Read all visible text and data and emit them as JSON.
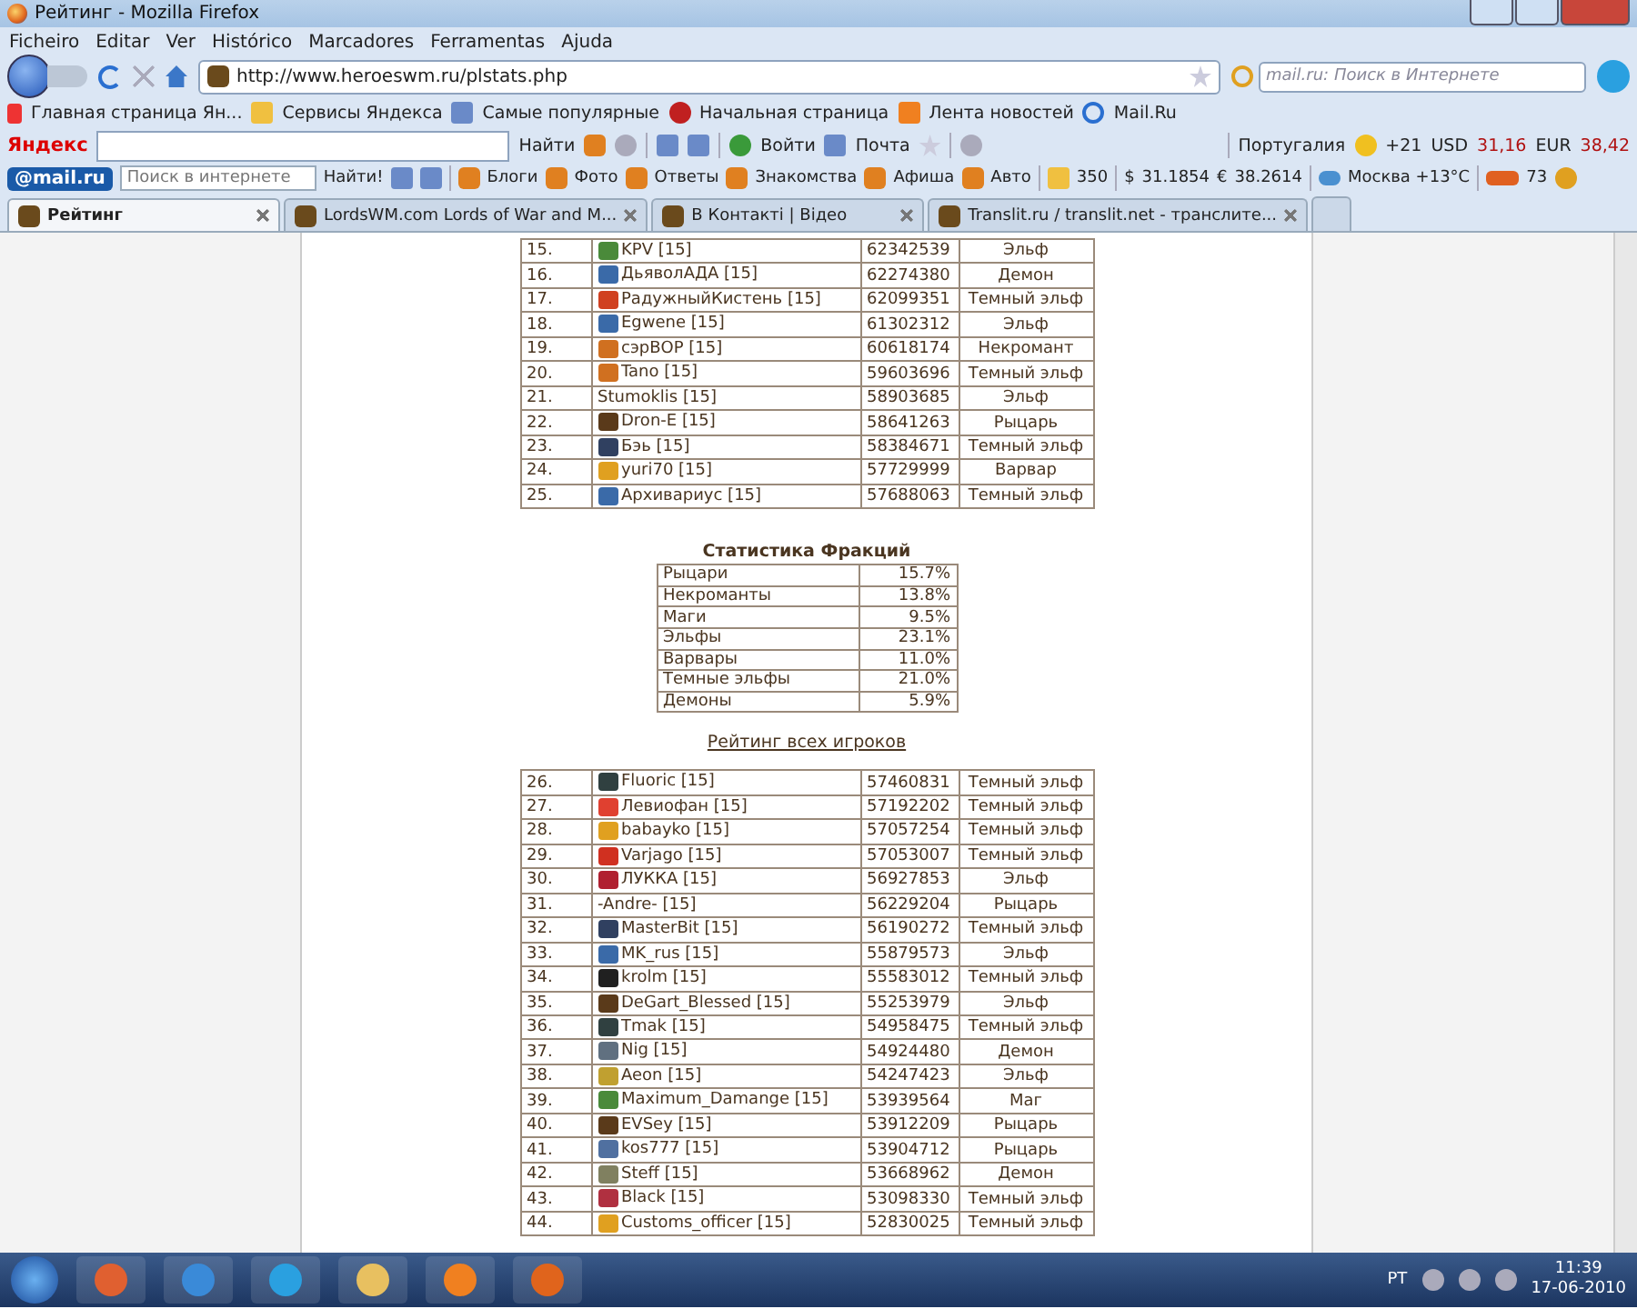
{
  "window": {
    "title": "Рейтинг - Mozilla Firefox"
  },
  "menu": [
    "Ficheiro",
    "Editar",
    "Ver",
    "Histórico",
    "Marcadores",
    "Ferramentas",
    "Ajuda"
  ],
  "navigation": {
    "url": "http://www.heroeswm.ru/plstats.php",
    "search": {
      "placeholder": "mail.ru: Поиск в Интернете"
    }
  },
  "bookmarks": [
    "Главная страница Ян...",
    "Сервисы Яндекса",
    "Самые популярные",
    "Начальная страница",
    "Лента новостей",
    "Mail.Ru"
  ],
  "yandex_bar": {
    "logo": "Яндекс",
    "find": "Найти",
    "login": "Войти",
    "mail": "Почта",
    "region": "Португалия",
    "temperature": "+21",
    "usd_label": "USD",
    "usd": "31,16",
    "eur_label": "EUR",
    "eur": "38,42"
  },
  "mail_bar": {
    "logo": "@mail.ru",
    "search": {
      "placeholder": "Поиск в интернете"
    },
    "find": "Найти!",
    "links": [
      "Блоги",
      "Фото",
      "Ответы",
      "Знакомства",
      "Афиша",
      "Авто"
    ],
    "messages": "350",
    "dollar_sign": "$",
    "dollar": "31.1854",
    "euro_sign": "€",
    "euro": "38.2614",
    "weather": "Москва +13°C",
    "traffic": "73"
  },
  "tabs": [
    {
      "label": "Рейтинг",
      "selected": true
    },
    {
      "label": "LordsWM.com Lords of War and M...",
      "selected": false
    },
    {
      "label": "В Контакті | Відео",
      "selected": false
    },
    {
      "label": "Translit.ru / translit.net - транслите...",
      "selected": false
    }
  ],
  "ranking_top": {
    "rows": [
      {
        "rank": "15.",
        "name": "KPV [15]",
        "score": "62342539",
        "faction": "Эльф",
        "color": "#4a8a3a"
      },
      {
        "rank": "16.",
        "name": "ДьяволАДА [15]",
        "score": "62274380",
        "faction": "Демон",
        "color": "#3a6aa8"
      },
      {
        "rank": "17.",
        "name": "РадужныйКистень [15]",
        "score": "62099351",
        "faction": "Темный эльф",
        "color": "#d04020"
      },
      {
        "rank": "18.",
        "name": "Egwene [15]",
        "score": "61302312",
        "faction": "Эльф",
        "color": "#3a6aa8"
      },
      {
        "rank": "19.",
        "name": "сэрВОР [15]",
        "score": "60618174",
        "faction": "Некромант",
        "color": "#d07020"
      },
      {
        "rank": "20.",
        "name": "Tano [15]",
        "score": "59603696",
        "faction": "Темный эльф",
        "color": "#d07020"
      },
      {
        "rank": "21.",
        "name": "Stumoklis [15]",
        "score": "58903685",
        "faction": "Эльф"
      },
      {
        "rank": "22.",
        "name": "Dron-E [15]",
        "score": "58641263",
        "faction": "Рыцарь",
        "color": "#5a3a1a"
      },
      {
        "rank": "23.",
        "name": "Бэь [15]",
        "score": "58384671",
        "faction": "Темный эльф",
        "color": "#304060"
      },
      {
        "rank": "24.",
        "name": "yuri70 [15]",
        "score": "57729999",
        "faction": "Варвар",
        "color": "#e0a020"
      },
      {
        "rank": "25.",
        "name": "Архивариус [15]",
        "score": "57688063",
        "faction": "Темный эльф",
        "color": "#3a6aa8"
      }
    ]
  },
  "faction_stats": {
    "title": "Статистика Фракций",
    "rows": [
      {
        "faction": "Рыцари",
        "share": "15.7%"
      },
      {
        "faction": "Некроманты",
        "share": "13.8%"
      },
      {
        "faction": "Маги",
        "share": "9.5%"
      },
      {
        "faction": "Эльфы",
        "share": "23.1%"
      },
      {
        "faction": "Варвары",
        "share": "11.0%"
      },
      {
        "faction": "Темные эльфы",
        "share": "21.0%"
      },
      {
        "faction": "Демоны",
        "share": "5.9%"
      }
    ]
  },
  "all_players_link": "Рейтинг всех игроков",
  "ranking": {
    "rows": [
      {
        "rank": "26.",
        "name": "Fluoric [15]",
        "score": "57460831",
        "faction": "Темный эльф",
        "color": "#304040"
      },
      {
        "rank": "27.",
        "name": "Левиофан [15]",
        "score": "57192202",
        "faction": "Темный эльф",
        "color": "#e04030"
      },
      {
        "rank": "28.",
        "name": "babayko [15]",
        "score": "57057254",
        "faction": "Темный эльф",
        "color": "#e0a020"
      },
      {
        "rank": "29.",
        "name": "Varjago [15]",
        "score": "57053007",
        "faction": "Темный эльф",
        "color": "#d03020"
      },
      {
        "rank": "30.",
        "name": "ЛУККА [15]",
        "score": "56927853",
        "faction": "Эльф",
        "color": "#b02030"
      },
      {
        "rank": "31.",
        "name": "-Andre- [15]",
        "score": "56229204",
        "faction": "Рыцарь"
      },
      {
        "rank": "32.",
        "name": "MasterBit [15]",
        "score": "56190272",
        "faction": "Темный эльф",
        "color": "#304060"
      },
      {
        "rank": "33.",
        "name": "MK_rus [15]",
        "score": "55879573",
        "faction": "Эльф",
        "color": "#3a6aa8"
      },
      {
        "rank": "34.",
        "name": "krolm [15]",
        "score": "55583012",
        "faction": "Темный эльф",
        "color": "#202020"
      },
      {
        "rank": "35.",
        "name": "DeGart_Blessed [15]",
        "score": "55253979",
        "faction": "Эльф",
        "color": "#5a3a1a"
      },
      {
        "rank": "36.",
        "name": "Tmak [15]",
        "score": "54958475",
        "faction": "Темный эльф",
        "color": "#304040"
      },
      {
        "rank": "37.",
        "name": "Nig [15]",
        "score": "54924480",
        "faction": "Демон",
        "color": "#607080"
      },
      {
        "rank": "38.",
        "name": "Aeon [15]",
        "score": "54247423",
        "faction": "Эльф",
        "color": "#c0a030"
      },
      {
        "rank": "39.",
        "name": "Maximum_Damange [15]",
        "score": "53939564",
        "faction": "Маг",
        "color": "#4a8a3a"
      },
      {
        "rank": "40.",
        "name": "EVSey [15]",
        "score": "53912209",
        "faction": "Рыцарь",
        "color": "#5a3a1a"
      },
      {
        "rank": "41.",
        "name": "kos777 [15]",
        "score": "53904712",
        "faction": "Рыцарь",
        "color": "#5070a0"
      },
      {
        "rank": "42.",
        "name": "Steff [15]",
        "score": "53668962",
        "faction": "Демон",
        "color": "#808060"
      },
      {
        "rank": "43.",
        "name": "Black [15]",
        "score": "53098330",
        "faction": "Темный эльф",
        "color": "#b03040"
      },
      {
        "rank": "44.",
        "name": "Customs_officer [15]",
        "score": "52830025",
        "faction": "Темный эльф",
        "color": "#e0a020"
      }
    ]
  },
  "taskbar": {
    "language": "PT",
    "time": "11:39",
    "date": "17-06-2010"
  }
}
